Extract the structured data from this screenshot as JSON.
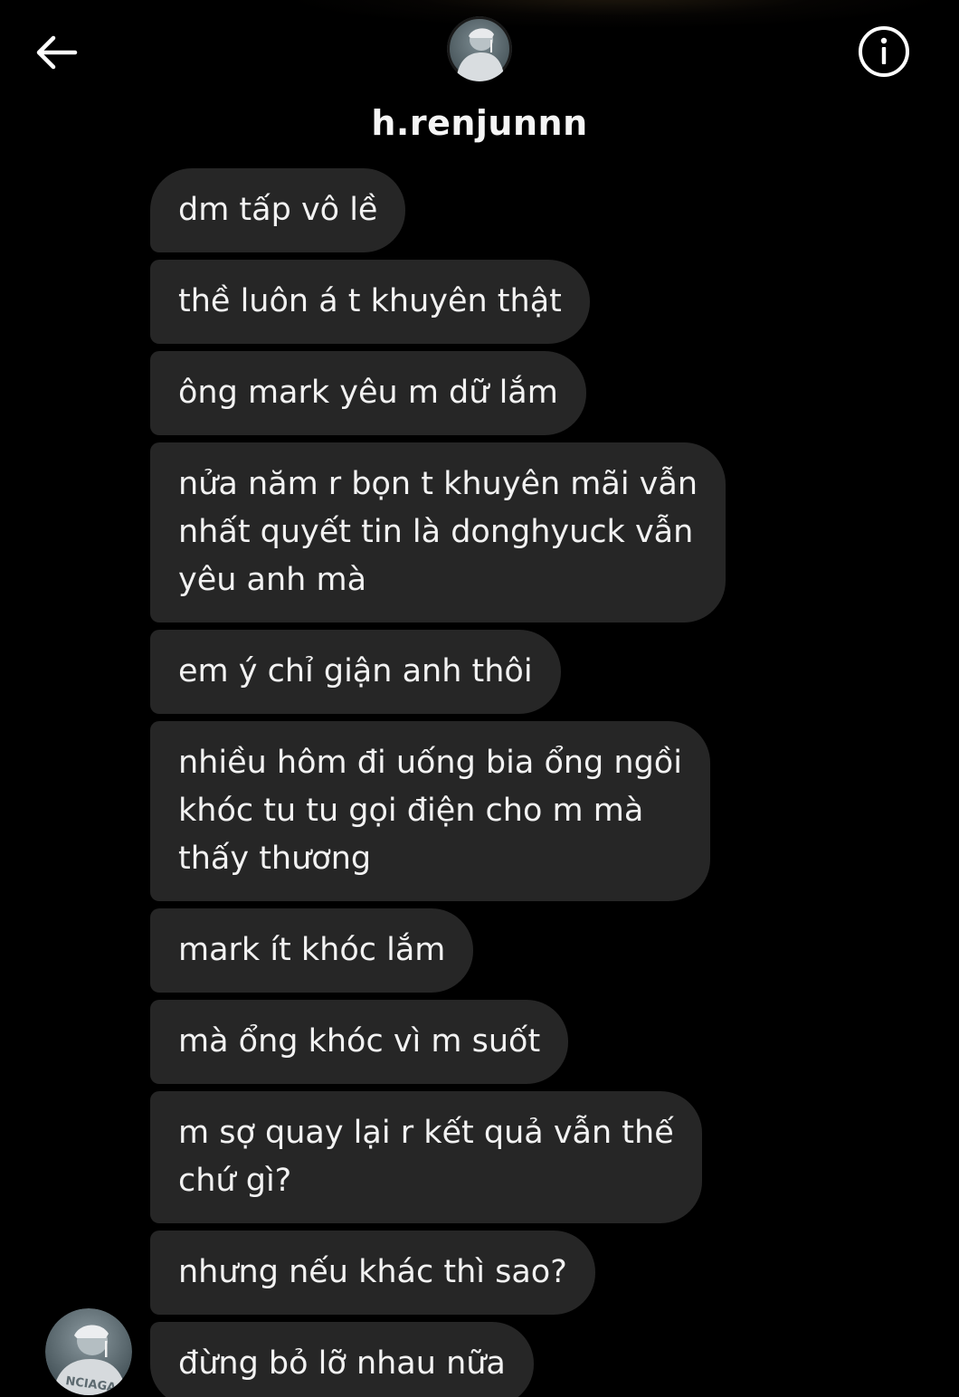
{
  "header": {
    "back_icon": "arrow-left-icon",
    "info_icon": "info-circle-icon",
    "avatar_icon": "profile-avatar",
    "username": "h.renjunnn"
  },
  "colors": {
    "background": "#000000",
    "bubble": "#262626",
    "text": "#f2f2f2"
  },
  "messages": [
    "dm tấp vô lề",
    "thề luôn á t khuyên thật",
    "ông mark yêu m dữ lắm",
    "nửa năm r bọn t khuyên mãi vẫn\nnhất quyết tin là donghyuck vẫn\nyêu anh mà",
    "em ý chỉ giận anh thôi",
    "nhiều hôm đi uống bia ổng ngồi\nkhóc tu tu gọi điện cho m mà\nthấy thương",
    "mark ít khóc lắm",
    "mà ổng khóc vì m suốt",
    "m sợ quay lại r kết quả vẫn thế\nchứ gì?",
    "nhưng nếu khác thì sao?",
    "đừng bỏ lỡ nhau nữa"
  ],
  "avatar_print_text": "NCIAGA"
}
